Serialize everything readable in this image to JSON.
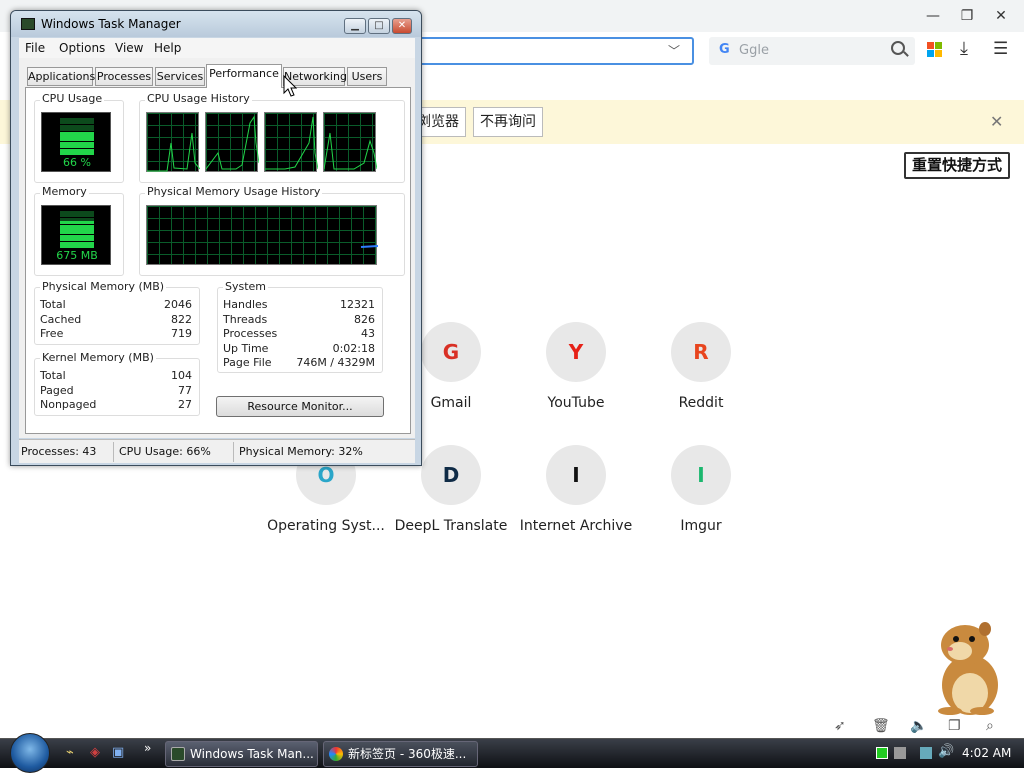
{
  "browser": {
    "search_placeholder": "Ggle",
    "infobar": {
      "btn1": "浏览器",
      "btn2": "不再询问"
    },
    "reset_label": "重置快捷方式",
    "sites": [
      {
        "letter": "G",
        "name": "Gmail",
        "color": "#d93025"
      },
      {
        "letter": "Y",
        "name": "YouTube",
        "color": "#e62117"
      },
      {
        "letter": "R",
        "name": "Reddit",
        "color": "#e8451e"
      },
      {
        "letter": "O",
        "name": "Operating Syst...",
        "color": "#2aa6c9"
      },
      {
        "letter": "D",
        "name": "DeepL Translate",
        "color": "#0f2b46"
      },
      {
        "letter": "I",
        "name": "Internet Archive",
        "color": "#111111"
      },
      {
        "letter": "I",
        "name": "Imgur",
        "color": "#1bb76e"
      }
    ]
  },
  "taskmgr": {
    "title": "Windows Task Manager",
    "menu": [
      "File",
      "Options",
      "View",
      "Help"
    ],
    "tabs": [
      "Applications",
      "Processes",
      "Services",
      "Performance",
      "Networking",
      "Users"
    ],
    "active_tab": "Performance",
    "cpu_usage_label": "CPU Usage",
    "cpu_usage_value": "66 %",
    "cpu_usage_fraction": 0.66,
    "cpu_history_label": "CPU Usage History",
    "memory_label": "Memory",
    "memory_value": "675 MB",
    "phys_history_label": "Physical Memory Usage History",
    "physical_memory": {
      "title": "Physical Memory (MB)",
      "rows": [
        [
          "Total",
          "2046"
        ],
        [
          "Cached",
          "822"
        ],
        [
          "Free",
          "719"
        ]
      ]
    },
    "kernel_memory": {
      "title": "Kernel Memory (MB)",
      "rows": [
        [
          "Total",
          "104"
        ],
        [
          "Paged",
          "77"
        ],
        [
          "Nonpaged",
          "27"
        ]
      ]
    },
    "system": {
      "title": "System",
      "rows": [
        [
          "Handles",
          "12321"
        ],
        [
          "Threads",
          "826"
        ],
        [
          "Processes",
          "43"
        ],
        [
          "Up Time",
          "0:02:18"
        ],
        [
          "Page File",
          "746M / 4329M"
        ]
      ]
    },
    "resource_monitor_label": "Resource Monitor...",
    "status": {
      "processes": "Processes: 43",
      "cpu": "CPU Usage: 66%",
      "memory": "Physical Memory: 32%"
    }
  },
  "taskbar": {
    "items": [
      "Windows Task Man...",
      "新标签页 - 360极速..."
    ],
    "clock": "4:02 AM"
  },
  "colors": {
    "accent": "#4a90e2",
    "monitor_green": "#22d64a",
    "infobar": "#fdf7d9"
  }
}
